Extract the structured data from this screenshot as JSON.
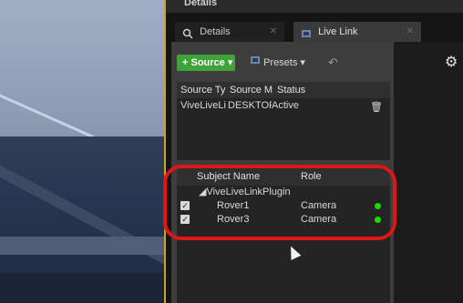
{
  "window": {
    "top_title": "Details",
    "tabs": [
      {
        "label": "Details"
      },
      {
        "label": "Live Link"
      }
    ]
  },
  "toolbar": {
    "source_label": "+ Source ▾",
    "presets_label": "Presets ▾",
    "undo_glyph": "↶",
    "settings_glyph": "⚙"
  },
  "sources": {
    "columns": [
      "Source Ty",
      "Source M",
      "Status"
    ],
    "rows": [
      {
        "type": "ViveLiveLi",
        "machine": "DESKTOP-",
        "status": "Active"
      }
    ]
  },
  "subjects": {
    "columns": [
      "Subject Name",
      "Role"
    ],
    "group": "◢ViveLiveLinkPlugin",
    "rows": [
      {
        "name": "Rover1",
        "role": "Camera",
        "checked": true,
        "status_color": "#14e000"
      },
      {
        "name": "Rover3",
        "role": "Camera",
        "checked": true,
        "status_color": "#14e000"
      }
    ]
  },
  "colors": {
    "source_button": "#3fa33a",
    "highlight": "#e01515",
    "status_dot": "#14e000"
  }
}
